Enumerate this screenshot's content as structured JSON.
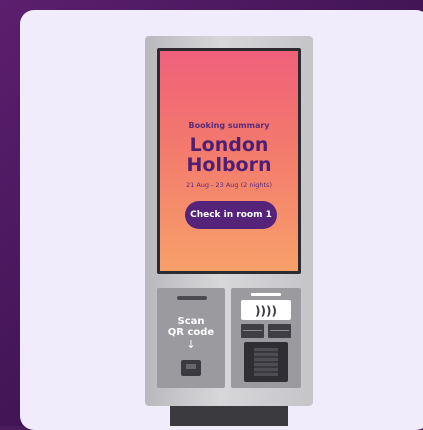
{
  "booking": {
    "heading": "Booking summary",
    "hotel_line1": "London",
    "hotel_line2": "Holborn",
    "dates": "21 Aug - 23 Aug (2 nights)",
    "checkin_label": "Check in room 1"
  },
  "scanner": {
    "label_line1": "Scan",
    "label_line2": "QR code",
    "arrow": "↓"
  },
  "payment": {
    "nfc_symbol": "))))"
  },
  "colors": {
    "background": "#4a1a5c",
    "card": "#f1ecfb",
    "screen_top": "#f0607a",
    "screen_bottom": "#f7a06a",
    "brand_purple": "#56237a"
  },
  "icons": [
    "arrow-down-icon",
    "contactless-icon",
    "qr-scanner-icon",
    "keypad-icon",
    "card-terminal-icon"
  ]
}
